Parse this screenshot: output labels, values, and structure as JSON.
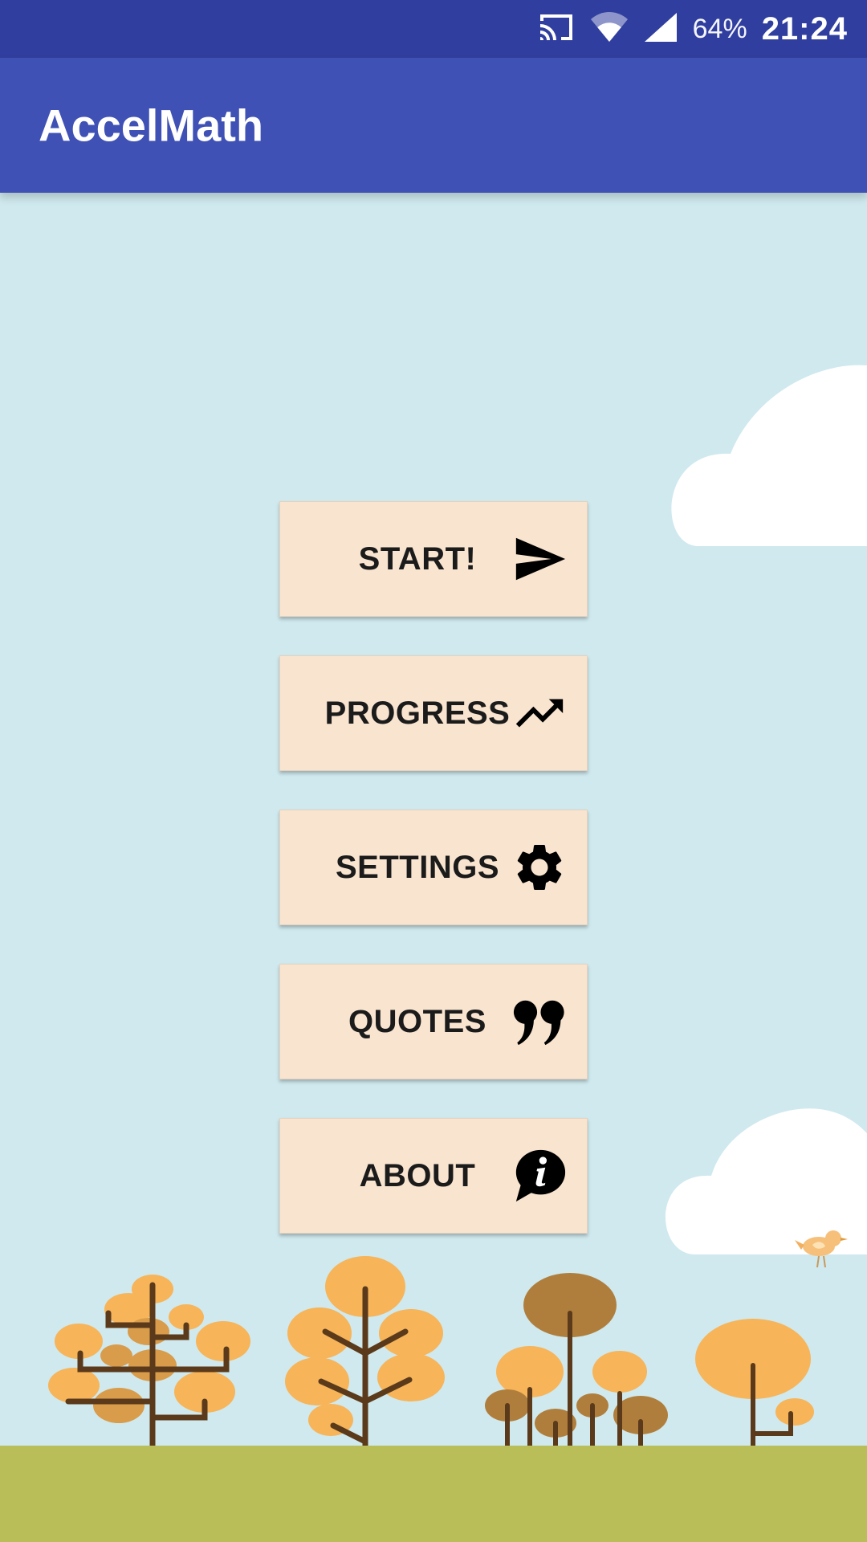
{
  "status_bar": {
    "battery": "64%",
    "time": "21:24",
    "icons": [
      "cast-icon",
      "wifi-icon",
      "cell-signal-icon"
    ]
  },
  "app_bar": {
    "title": "AccelMath"
  },
  "menu": {
    "buttons": [
      {
        "label": "START!",
        "icon": "send-icon"
      },
      {
        "label": "PROGRESS",
        "icon": "trending-up-icon"
      },
      {
        "label": "SETTINGS",
        "icon": "gear-icon"
      },
      {
        "label": "QUOTES",
        "icon": "quote-icon"
      },
      {
        "label": "ABOUT",
        "icon": "info-bubble-icon"
      }
    ]
  },
  "colors": {
    "status_bar": "#303f9f",
    "app_bar": "#3f51b5",
    "sky": "#cfe9ee",
    "button_bg": "#f9e4cf",
    "ground": "#b9be58",
    "tree_orange": "#f7b458",
    "tree_brown": "#b07e3c",
    "trunk": "#5a3a1a"
  }
}
